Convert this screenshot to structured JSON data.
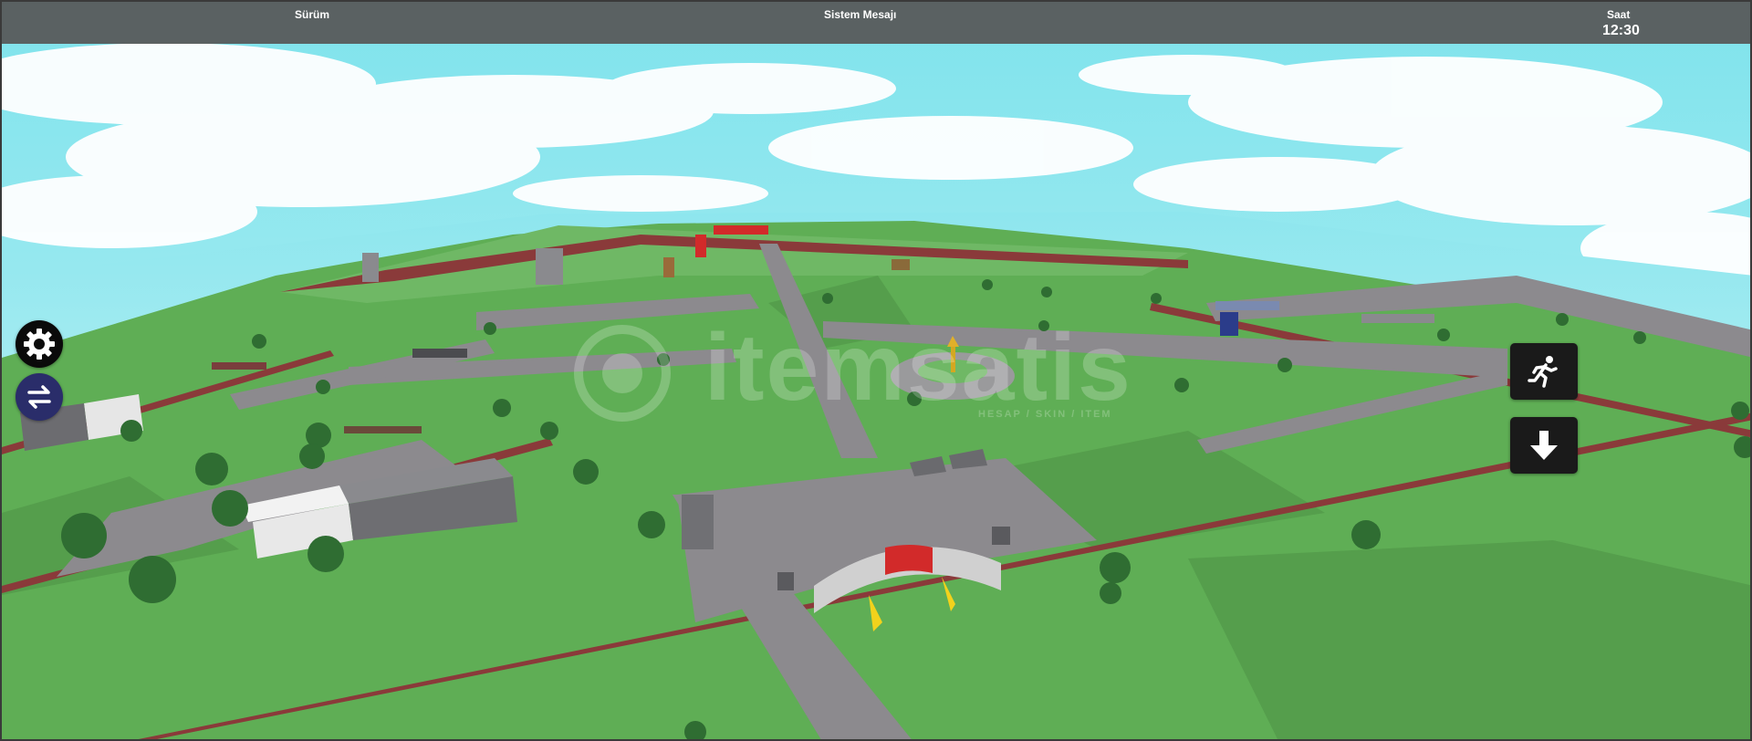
{
  "topbar": {
    "version_label": "Sürüm",
    "system_message_label": "Sistem Mesajı",
    "clock_label": "Saat",
    "clock_value": "12:30"
  },
  "watermark": {
    "text": "itemsatis",
    "subtitle": "HESAP / SKIN / ITEM"
  },
  "controls": {
    "left": [
      {
        "name": "settings-button",
        "icon": "gear-icon"
      },
      {
        "name": "switch-button",
        "icon": "swap-arrows-icon"
      }
    ],
    "right": [
      {
        "name": "sprint-button",
        "icon": "running-person-icon"
      },
      {
        "name": "descend-button",
        "icon": "arrow-down-icon"
      }
    ]
  },
  "colors": {
    "topbar": "#585c5c",
    "sky": "#7fe3ec",
    "grass": "#5fae55",
    "road": "#8c8a8e",
    "wall": "#8a3a3a",
    "button_dark": "#1a1a1a",
    "button_switch": "#2a2d6a",
    "gate_red": "#d22a2a"
  }
}
